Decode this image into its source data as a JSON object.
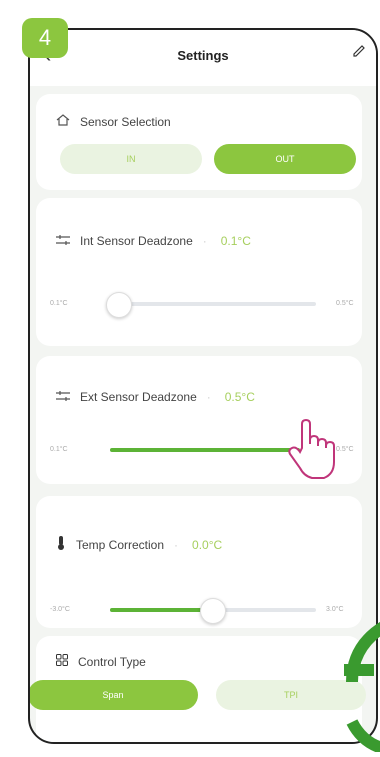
{
  "step_badge": "4",
  "header": {
    "title": "Settings"
  },
  "sensor_selection": {
    "title": "Sensor Selection",
    "options": [
      "IN",
      "OUT"
    ],
    "selected": "OUT"
  },
  "int_deadzone": {
    "title": "Int Sensor Deadzone",
    "value": "0.1°C",
    "min_label": "0.1°C",
    "max_label": "0.5°C",
    "level": 0.0
  },
  "ext_deadzone": {
    "title": "Ext Sensor Deadzone",
    "value": "0.5°C",
    "min_label": "0.1°C",
    "max_label": "0.5°C",
    "level": 1.0
  },
  "temp_correction": {
    "title": "Temp Correction",
    "value": "0.0°C",
    "min_label": "-3.0°C",
    "max_label": "3.0°C",
    "level": 0.5
  },
  "control_type": {
    "title": "Control Type",
    "options": [
      "Span",
      "TPI"
    ],
    "selected": "Span"
  },
  "accent_color": "#8cc63f"
}
